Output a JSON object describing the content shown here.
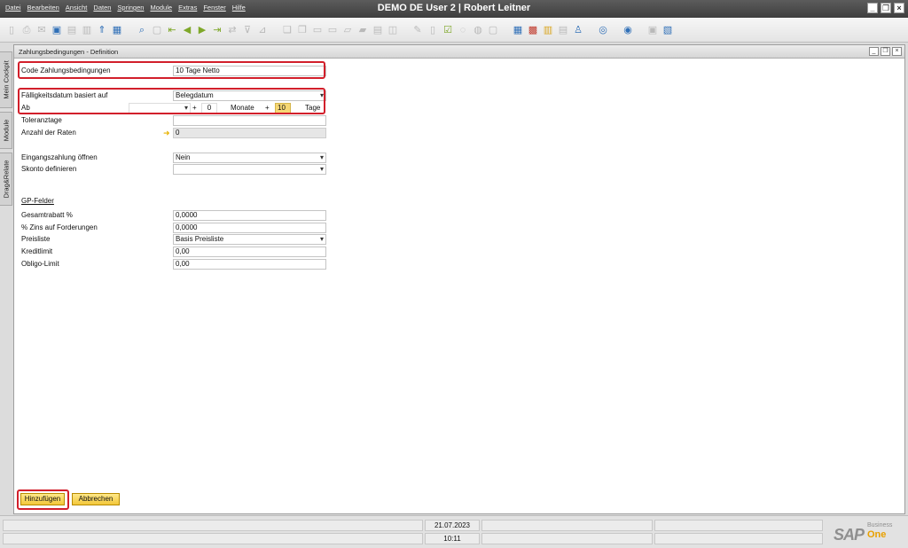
{
  "window": {
    "title": "DEMO DE User 2 | Robert Leitner"
  },
  "menu": [
    "Datei",
    "Bearbeiten",
    "Ansicht",
    "Daten",
    "Springen",
    "Module",
    "Extras",
    "Fenster",
    "Hilfe"
  ],
  "sidetabs": [
    "Mein Cockpit",
    "Module",
    "Drag&Relate"
  ],
  "form": {
    "title": "Zahlungsbedingungen - Definition",
    "code_label": "Code Zahlungsbedingungen",
    "code_value": "10 Tage Netto",
    "due_label": "Fälligkeitsdatum basiert auf",
    "due_value": "Belegdatum",
    "ab_label": "Ab",
    "ab_value": "",
    "plus1": "+",
    "months_value": "0",
    "months_label": "Monate",
    "plus2": "+",
    "days_value": "10",
    "days_label": "Tage",
    "tolerance_label": "Toleranztage",
    "tolerance_value": "",
    "installments_label": "Anzahl der Raten",
    "installments_value": "0",
    "incoming_label": "Eingangszahlung öffnen",
    "incoming_value": "Nein",
    "discount_label": "Skonto definieren",
    "discount_value": "",
    "bp_section": "GP-Felder",
    "total_discount_label": "Gesamtrabatt %",
    "total_discount_value": "0,0000",
    "interest_label": "% Zins auf Forderungen",
    "interest_value": "0,0000",
    "pricelist_label": "Preisliste",
    "pricelist_value": "Basis Preisliste",
    "credit_label": "Kreditlimit",
    "credit_value": "0,00",
    "commitment_label": "Obligo-Limit",
    "commitment_value": "0,00",
    "add_button": "Hinzufügen",
    "cancel_button": "Abbrechen"
  },
  "status": {
    "date": "21.07.2023",
    "time": "10:11"
  },
  "branding": {
    "sap": "SAP",
    "business": "Business",
    "one": "One"
  },
  "colors": {
    "highlight": "#d21f2b",
    "button": "#f3c73a",
    "titlebar": "#4a4a4a"
  }
}
